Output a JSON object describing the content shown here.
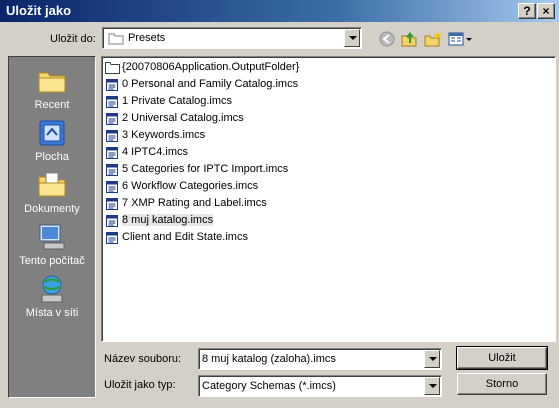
{
  "window": {
    "title": "Uložit jako"
  },
  "titlebar_buttons": {
    "help": "?",
    "close": "×"
  },
  "location": {
    "label": "Uložit do:",
    "value": "Presets"
  },
  "places": [
    {
      "label": "Recent",
      "icon": "recent-folder-icon"
    },
    {
      "label": "Plocha",
      "icon": "desktop-icon"
    },
    {
      "label": "Dokumenty",
      "icon": "documents-folder-icon"
    },
    {
      "label": "Tento počítač",
      "icon": "my-computer-icon"
    },
    {
      "label": "Místa v síti",
      "icon": "network-places-icon"
    }
  ],
  "files": [
    {
      "name": "{20070806Application.OutputFolder}",
      "type": "folder"
    },
    {
      "name": "0 Personal and Family Catalog.imcs",
      "type": "file"
    },
    {
      "name": "1 Private Catalog.imcs",
      "type": "file"
    },
    {
      "name": "2 Universal Catalog.imcs",
      "type": "file"
    },
    {
      "name": "3 Keywords.imcs",
      "type": "file"
    },
    {
      "name": "4 IPTC4.imcs",
      "type": "file"
    },
    {
      "name": "5 Categories for IPTC Import.imcs",
      "type": "file"
    },
    {
      "name": "6 Workflow Categories.imcs",
      "type": "file"
    },
    {
      "name": "7 XMP Rating and Label.imcs",
      "type": "file"
    },
    {
      "name": "8 muj katalog.imcs",
      "type": "file",
      "selected": true
    },
    {
      "name": "Client and Edit State.imcs",
      "type": "file"
    }
  ],
  "filename": {
    "label": "Název souboru:",
    "value": "8 muj katalog (zaloha).imcs"
  },
  "filetype": {
    "label": "Uložit jako typ:",
    "value": "Category Schemas (*.imcs)"
  },
  "buttons": {
    "save": "Uložit",
    "cancel": "Storno"
  },
  "colors": {
    "title_start": "#0a246a",
    "title_end": "#a6caf0",
    "face": "#d4d0c8",
    "places_bg": "#808080"
  }
}
